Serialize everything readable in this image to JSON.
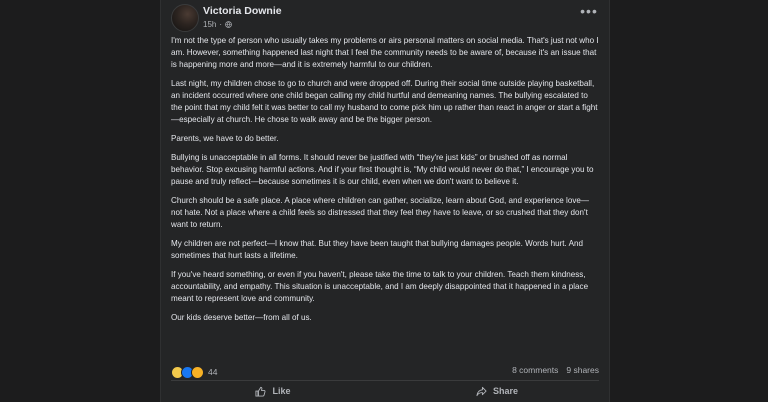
{
  "post": {
    "author": "Victoria Downie",
    "time": "15h",
    "separator": "·",
    "paragraphs": [
      "I'm not the type of person who usually takes my problems or airs personal matters on social media. That's just not who I am. However, something happened last night that I feel the community needs to be aware of, because it's an issue that is happening more and more—and it is extremely harmful to our children.",
      "Last night, my children chose to go to church and were dropped off. During their social time outside playing basketball, an incident occurred where one child began calling my child hurtful and demeaning names. The bullying escalated to the point that my child felt it was better to call my husband to come pick him up rather than react in anger or start a fight—especially at church. He chose to walk away and be the bigger person.",
      "Parents, we have to do better.",
      "Bullying is unacceptable in all forms. It should never be justified with “they're just kids” or brushed off as normal behavior. Stop excusing harmful actions. And if your first thought is, “My child would never do that,” I encourage you to pause and truly reflect—because sometimes it is our child, even when we don't want to believe it.",
      "Church should be a safe place. A place where children can gather, socialize, learn about God, and experience love—not hate. Not a place where a child feels so distressed that they feel they have to leave, or so crushed that they don't want to return.",
      "My children are not perfect—I know that. But they have been taught that bullying damages people. Words hurt. And sometimes that hurt lasts a lifetime.",
      "If you've heard something, or even if you haven't, please take the time to talk to your children. Teach them kindness, accountability, and empathy. This situation is unacceptable, and I am deeply disappointed that it happened in a place meant to represent love and community.",
      "Our kids deserve better—from all of us."
    ]
  },
  "footer": {
    "reaction_icons": [
      "care-reaction-icon",
      "like-reaction-icon",
      "sad-reaction-icon"
    ],
    "reaction_count": "44",
    "comments": "8 comments",
    "shares": "9 shares",
    "like_label": "Like",
    "share_label": "Share"
  },
  "colors": {
    "background": "#1c1c1d",
    "card": "#242526",
    "text": "#e4e6eb",
    "muted": "#b0b3b8",
    "like_blue": "#1877f2"
  }
}
